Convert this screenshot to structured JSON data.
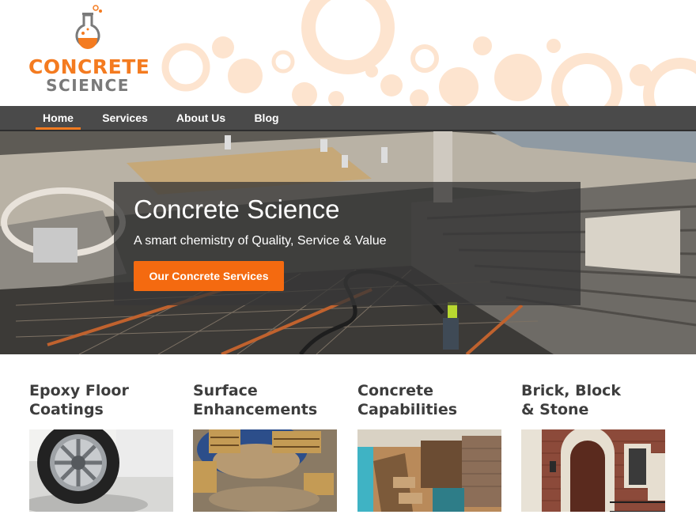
{
  "logo": {
    "line1": "CONCRETE",
    "line2": "SCIENCE",
    "accent": "#f47b20",
    "grey": "#7a7a7a"
  },
  "nav": {
    "items": [
      {
        "label": "Home",
        "active": true
      },
      {
        "label": "Services",
        "active": false
      },
      {
        "label": "About Us",
        "active": false
      },
      {
        "label": "Blog",
        "active": false
      }
    ]
  },
  "hero": {
    "title": "Concrete Science",
    "subtitle": "A smart chemistry of Quality, Service & Value",
    "button_label": "Our Concrete Services",
    "button_color": "#f46a10"
  },
  "services": [
    {
      "title_line1": "Epoxy Floor",
      "title_line2": "Coatings",
      "image": "car-wheel-epoxy-floor"
    },
    {
      "title_line1": "Surface",
      "title_line2": "Enhancements",
      "image": "library-polished-floor"
    },
    {
      "title_line1": "Concrete",
      "title_line2": "Capabilities",
      "image": "pool-water-feature"
    },
    {
      "title_line1": "Brick, Block",
      "title_line2": "& Stone",
      "image": "brick-house-entry"
    }
  ]
}
